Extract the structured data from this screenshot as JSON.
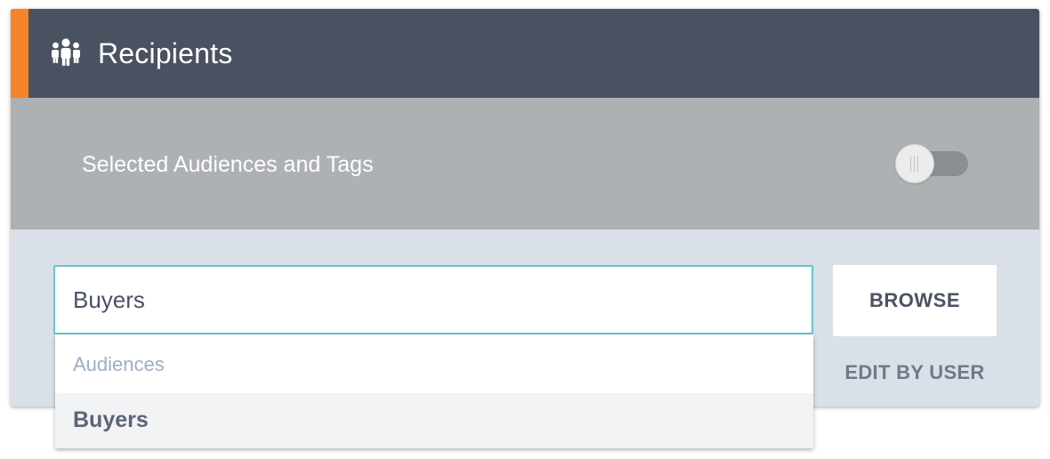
{
  "panel": {
    "title": "Recipients",
    "title_icon": "people-group-icon",
    "accent_color": "#f5842a",
    "header_color": "#4a5262"
  },
  "toggle_row": {
    "label": "Selected Audiences and Tags",
    "switch_state": "off"
  },
  "search": {
    "value": "Buyers",
    "placeholder": ""
  },
  "actions": {
    "browse_label": "BROWSE",
    "edit_by_user_label": "EDIT BY USER"
  },
  "dropdown": {
    "group_label": "Audiences",
    "items": [
      {
        "label": "Buyers"
      }
    ]
  }
}
